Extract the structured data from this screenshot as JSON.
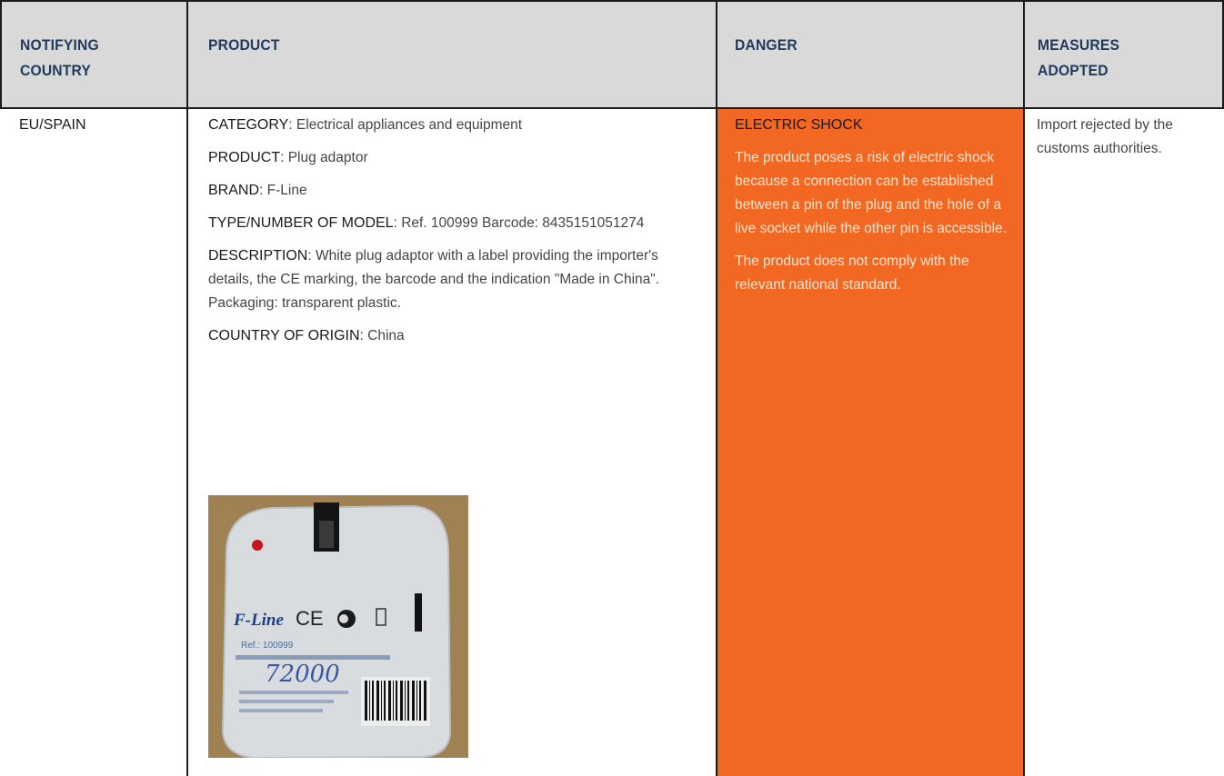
{
  "headers": {
    "notifying_country": "NOTIFYING COUNTRY",
    "product": "PRODUCT",
    "danger": "DANGER",
    "measures": "MEASURES ADOPTED"
  },
  "row": {
    "country": "EU/SPAIN",
    "product": {
      "category_label": "CATEGORY",
      "category_value": ": Electrical appliances and equipment",
      "product_label": "PRODUCT",
      "product_value": ": Plug adaptor",
      "brand_label": "BRAND",
      "brand_value": ": F-Line",
      "model_label": "TYPE/NUMBER OF MODEL",
      "model_value": ": Ref. 100999 Barcode: 8435151051274",
      "description_label": "DESCRIPTION",
      "description_value": ": White plug adaptor with a label providing the importer's details, the CE marking, the barcode and the indication \"Made in China\". Packaging: transparent plastic.",
      "origin_label": "COUNTRY OF ORIGIN",
      "origin_value": ": China"
    },
    "danger": {
      "title": "ELECTRIC SHOCK",
      "text1": "The product poses a risk of electric shock because a connection can be established between a pin of the plug and the hole of a live socket while the other pin is accessible.",
      "text2": "The product does not comply with the relevant national standard."
    },
    "measures": "Import rejected by the customs authorities."
  },
  "photo": {
    "brand_mark": "F-Line",
    "ce_mark": "CE",
    "ref_text": "Ref.: 100999",
    "handwritten": "72000"
  },
  "colors": {
    "header_bg": "#d9d9d9",
    "danger_bg": "#f26722",
    "header_text": "#1f3a5a"
  }
}
